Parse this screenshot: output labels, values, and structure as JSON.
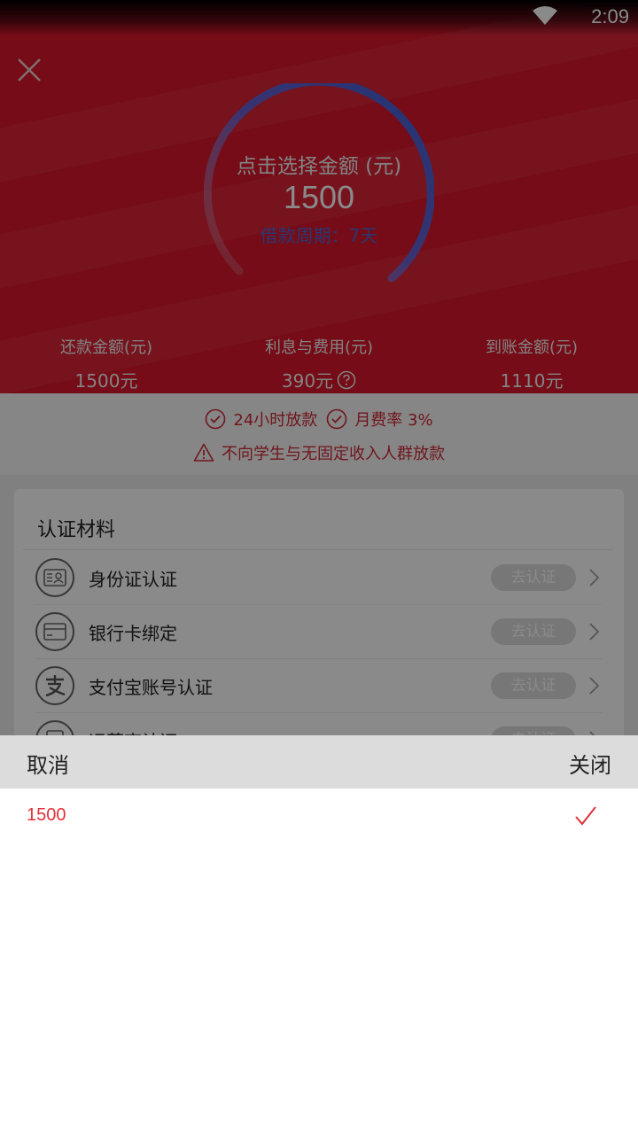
{
  "status_bar": {
    "time": "2:09"
  },
  "header": {
    "dial_title": "点击选择金额 (元)",
    "amount": "1500",
    "period": "借款周期：7天"
  },
  "stats": [
    {
      "label": "还款金额(元)",
      "value": "1500元"
    },
    {
      "label": "利息与费用(元)",
      "value": "390元"
    },
    {
      "label": "到账金额(元)",
      "value": "1110元"
    }
  ],
  "benefits": {
    "item1": "24小时放款",
    "item2": "月费率 3%",
    "warning": "不向学生与无固定收入人群放款"
  },
  "card": {
    "title": "认证材料",
    "items": [
      {
        "label": "身份证认证",
        "action": "去认证"
      },
      {
        "label": "银行卡绑定",
        "action": "去认证"
      },
      {
        "label": "支付宝账号认证",
        "action": "去认证"
      },
      {
        "label": "运营商认证",
        "action": "去认证"
      }
    ]
  },
  "sheet": {
    "cancel": "取消",
    "close": "关闭",
    "options": [
      {
        "value": "1500",
        "selected": true
      }
    ]
  },
  "colors": {
    "brand_red": "#d8172b",
    "accent_blue": "#4f67d2",
    "selected_red": "#e0303a"
  }
}
